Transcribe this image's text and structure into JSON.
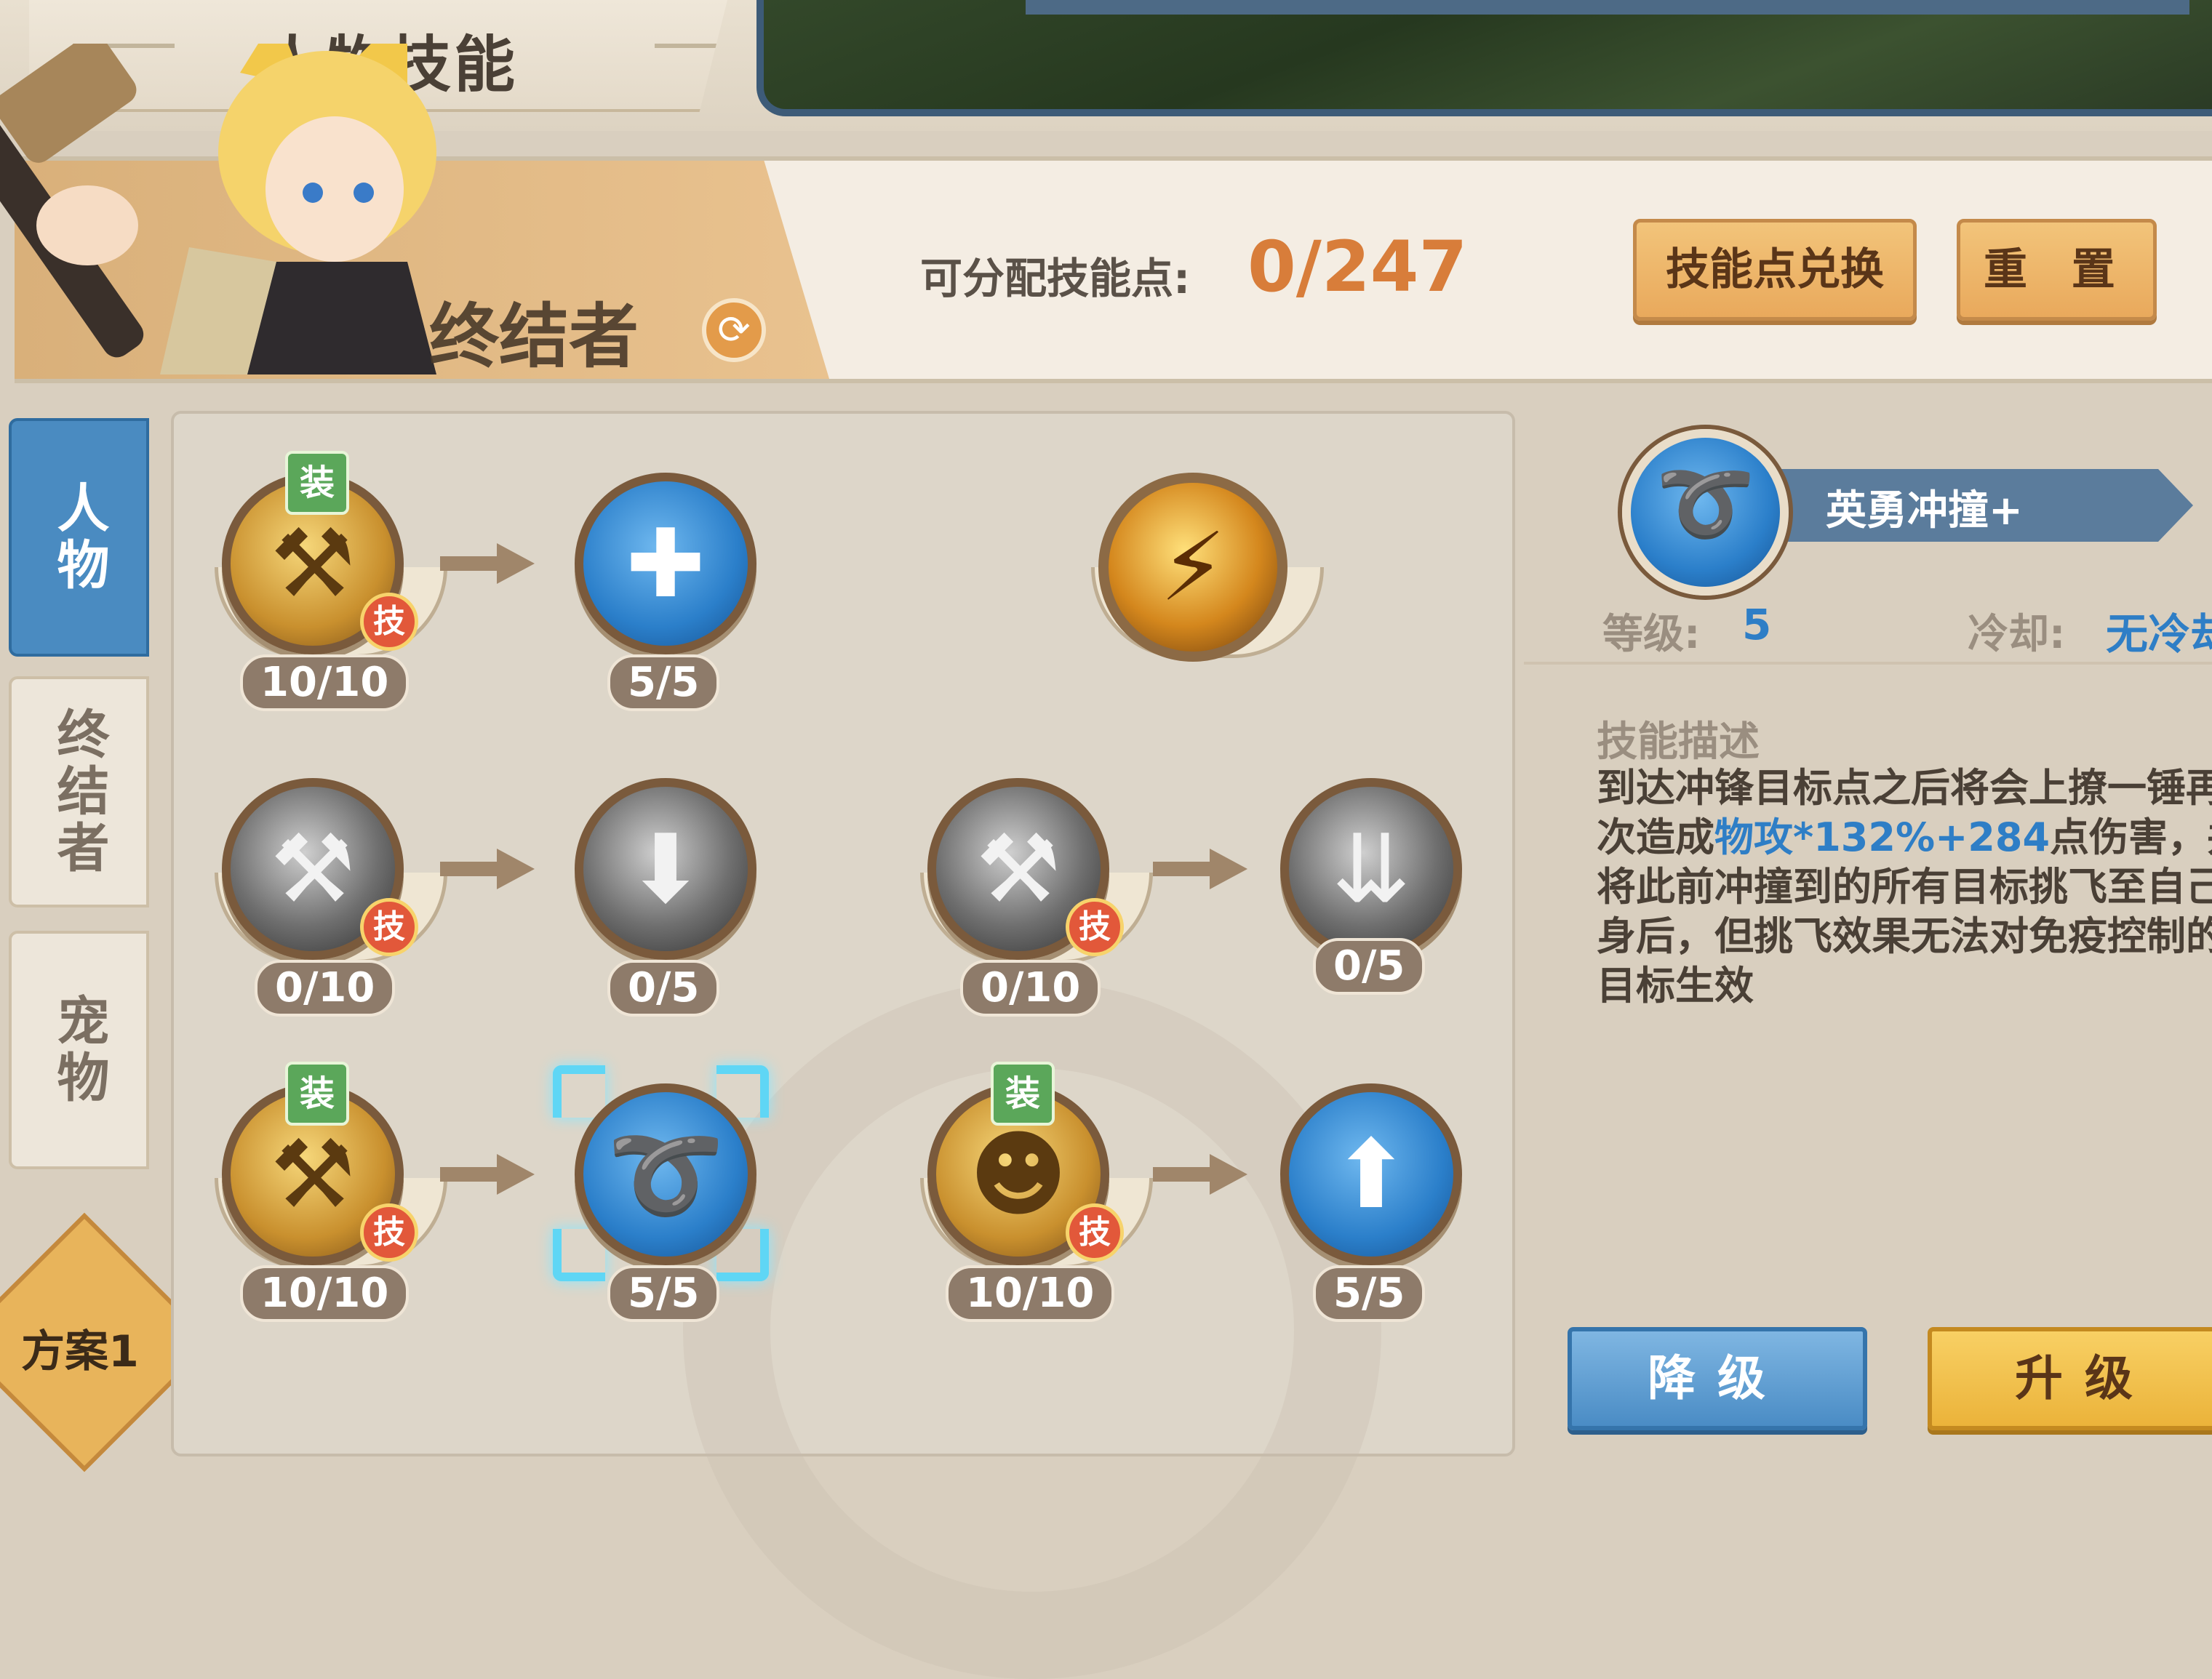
{
  "header": {
    "title": "人物技能",
    "class_name": "终结者",
    "points_label": "可分配技能点:",
    "points_value": "0/247",
    "exchange_button": "技能点兑换",
    "reset_button": "重 置"
  },
  "tabs": [
    {
      "label": "人物",
      "active": true
    },
    {
      "label": "终结者",
      "active": false
    },
    {
      "label": "宠物",
      "active": false
    }
  ],
  "scheme_label": "方案1",
  "badges": {
    "ji": "技",
    "zhuang": "装"
  },
  "skills": [
    {
      "id": "r1c1",
      "level": "10/10",
      "style": "gold",
      "icon": "golden-hammer-icon",
      "glyph": "⚒",
      "equipped": true,
      "skill_badge": true
    },
    {
      "id": "r1c2",
      "level": "5/5",
      "style": "blue",
      "icon": "hammer-plus-icon",
      "glyph": "✚"
    },
    {
      "id": "r1c3",
      "level": "",
      "style": "ult",
      "icon": "lightning-hammer-icon",
      "glyph": "⚡"
    },
    {
      "id": "r2c1",
      "level": "0/10",
      "style": "gray",
      "icon": "smash-icon",
      "glyph": "⚒",
      "skill_badge": true
    },
    {
      "id": "r2c2",
      "level": "0/5",
      "style": "gray",
      "icon": "boot-down-icon",
      "glyph": "⬇"
    },
    {
      "id": "r2c3",
      "level": "0/10",
      "style": "gray",
      "icon": "hammer-strike-icon",
      "glyph": "⚒",
      "skill_badge": true
    },
    {
      "id": "r2c4",
      "level": "0/5",
      "style": "gray",
      "icon": "pillars-icon",
      "glyph": "⇊"
    },
    {
      "id": "r3c1",
      "level": "10/10",
      "style": "gold",
      "icon": "hammer-throw-icon",
      "glyph": "⚒",
      "equipped": true,
      "skill_badge": true
    },
    {
      "id": "r3c2",
      "level": "5/5",
      "style": "blue",
      "icon": "brave-charge-icon",
      "glyph": "➰",
      "selected": true
    },
    {
      "id": "r3c3",
      "level": "10/10",
      "style": "gold",
      "icon": "rage-figure-icon",
      "glyph": "☻",
      "equipped": true,
      "skill_badge": true
    },
    {
      "id": "r3c4",
      "level": "5/5",
      "style": "blue",
      "icon": "hammer-shield-icon",
      "glyph": "⬆"
    }
  ],
  "detail": {
    "name": "英勇冲撞+",
    "level_label": "等级:",
    "level_value": "5",
    "cooldown_label": "冷却:",
    "cooldown_value": "无冷却",
    "desc_title": "技能描述",
    "desc_part1": "到达冲锋目标点之后将会上撩一锤再次造成",
    "desc_highlight": "物攻*132%+284",
    "desc_part2": "点伤害，并将此前冲撞到的所有目标挑飞至自己身后，但挑飞效果无法对免疫控制的目标生效",
    "downgrade_button": "降级",
    "upgrade_button": "升级"
  }
}
